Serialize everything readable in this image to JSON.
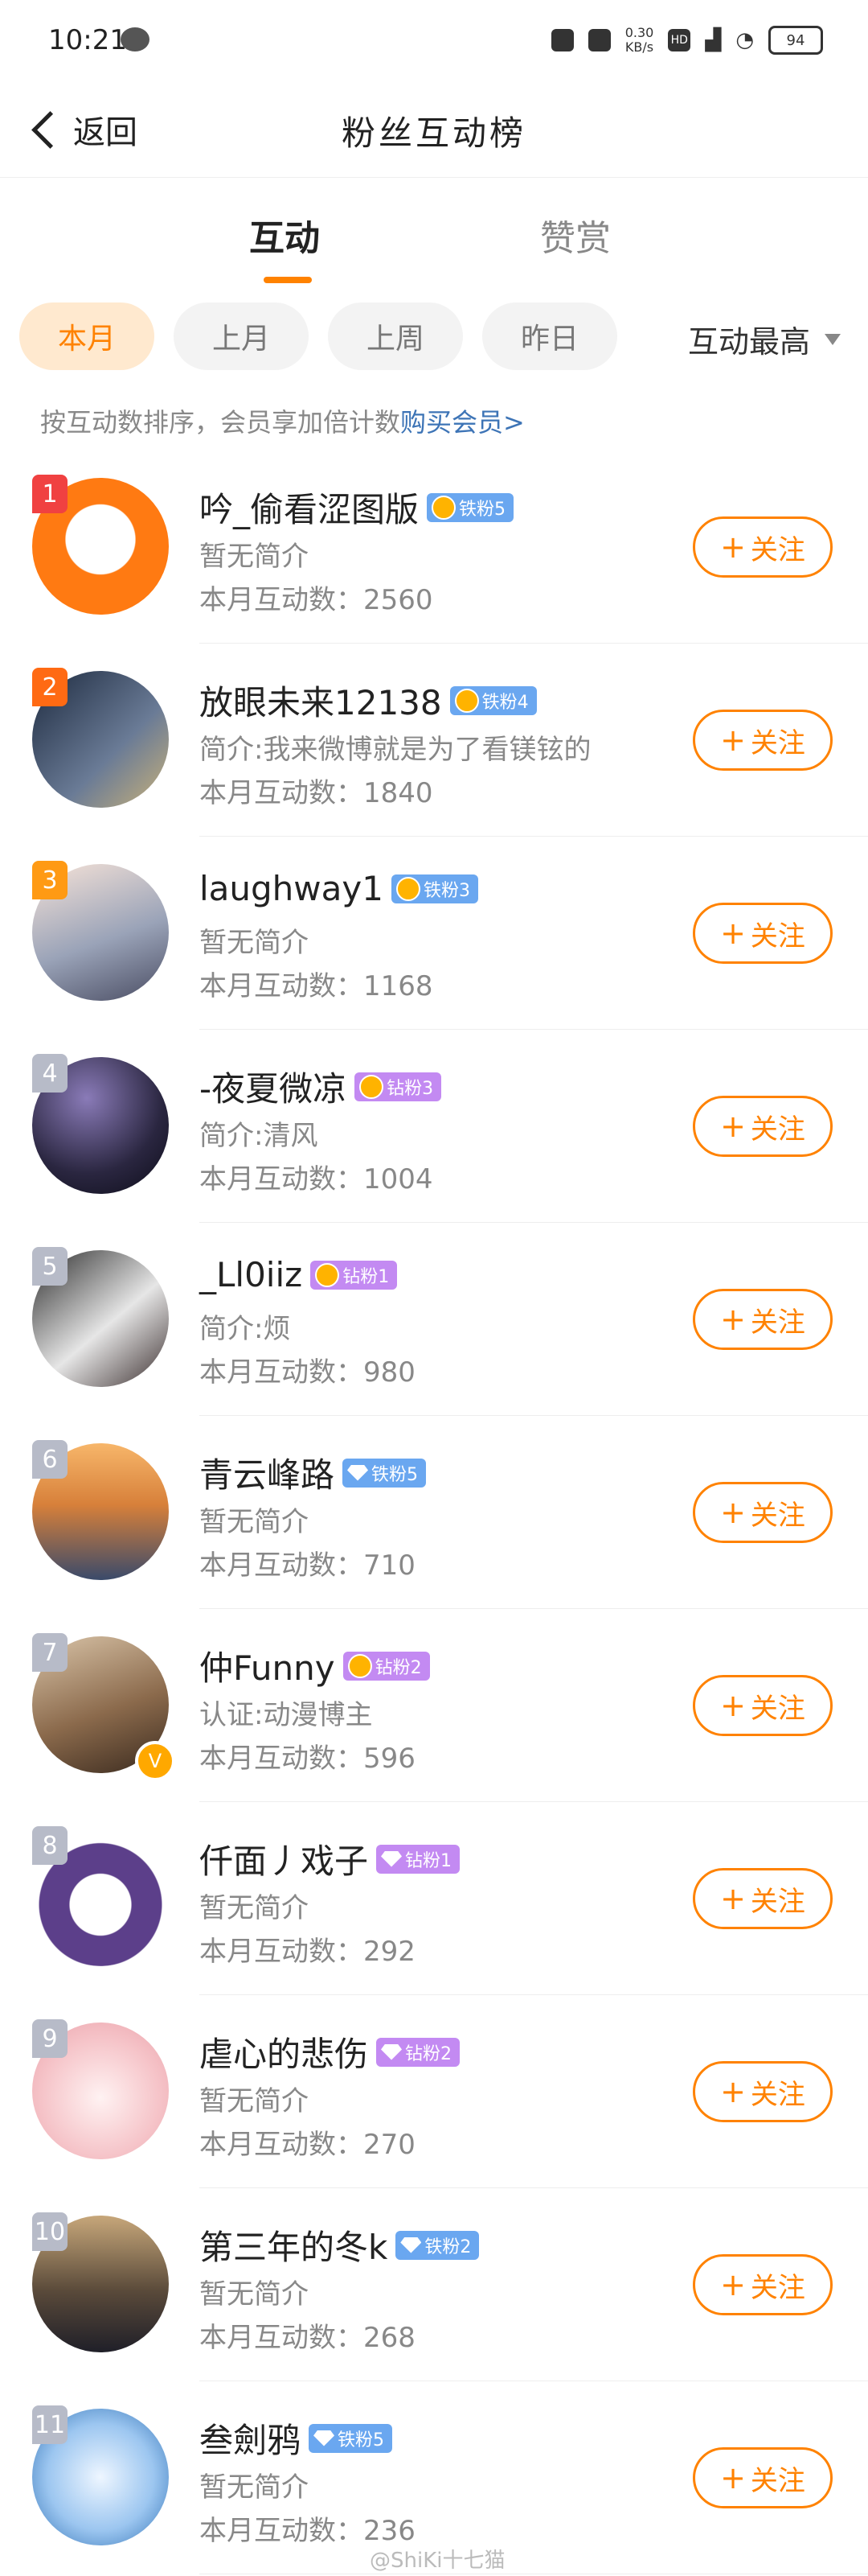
{
  "status": {
    "time": "10:21",
    "network": "0.30\nKB/s",
    "hd": "HD",
    "battery": "94"
  },
  "header": {
    "back_label": "返回",
    "title": "粉丝互动榜"
  },
  "tabs": [
    {
      "label": "互动"
    },
    {
      "label": "赞赏"
    }
  ],
  "filters": [
    {
      "label": "本月"
    },
    {
      "label": "上月"
    },
    {
      "label": "上周"
    },
    {
      "label": "昨日"
    }
  ],
  "sort": {
    "label": "互动最高"
  },
  "hint": {
    "text": "按互动数排序，会员享加倍计数",
    "link": "购买会员>"
  },
  "follow_label": "关注",
  "colors": {
    "accent": "#ff8200",
    "rank1": "#f04141",
    "rank2": "#ff6a13",
    "rank3": "#ff9a14",
    "rank_other": "#b7bbc8",
    "iron": "#6aa7f0",
    "diamond": "#c38af2"
  },
  "rows": [
    {
      "rank": "1",
      "name": "吟_偷看涩图版",
      "badge": "铁粉5",
      "bio": "暂无简介",
      "count": "本月互动数：2560"
    },
    {
      "rank": "2",
      "name": "放眼未来12138",
      "badge": "铁粉4",
      "bio": "简介:我来微博就是为了看镁铉的",
      "count": "本月互动数：1840"
    },
    {
      "rank": "3",
      "name": "laughway1",
      "badge": "铁粉3",
      "bio": "暂无简介",
      "count": "本月互动数：1168"
    },
    {
      "rank": "4",
      "name": "-夜夏微凉",
      "badge": "钻粉3",
      "bio": "简介:清风",
      "count": "本月互动数：1004"
    },
    {
      "rank": "5",
      "name": "_Ll0iiz",
      "badge": "钻粉1",
      "bio": "简介:烦",
      "count": "本月互动数：980"
    },
    {
      "rank": "6",
      "name": "青云峰路",
      "badge": "铁粉5",
      "bio": "暂无简介",
      "count": "本月互动数：710"
    },
    {
      "rank": "7",
      "name": "仲Funny",
      "badge": "钻粉2",
      "bio": "认证:动漫博主",
      "count": "本月互动数：596"
    },
    {
      "rank": "8",
      "name": "仟面丿戏子",
      "badge": "钻粉1",
      "bio": "暂无简介",
      "count": "本月互动数：292"
    },
    {
      "rank": "9",
      "name": "虐心的悲伤",
      "badge": "钻粉2",
      "bio": "暂无简介",
      "count": "本月互动数：270"
    },
    {
      "rank": "10",
      "name": "第三年的冬k",
      "badge": "铁粉2",
      "bio": "暂无简介",
      "count": "本月互动数：268"
    },
    {
      "rank": "11",
      "name": "叁劍鸦",
      "badge": "铁粉5",
      "bio": "暂无简介",
      "count": "本月互动数：236"
    }
  ],
  "watermark": "@ShiKi十七猫"
}
